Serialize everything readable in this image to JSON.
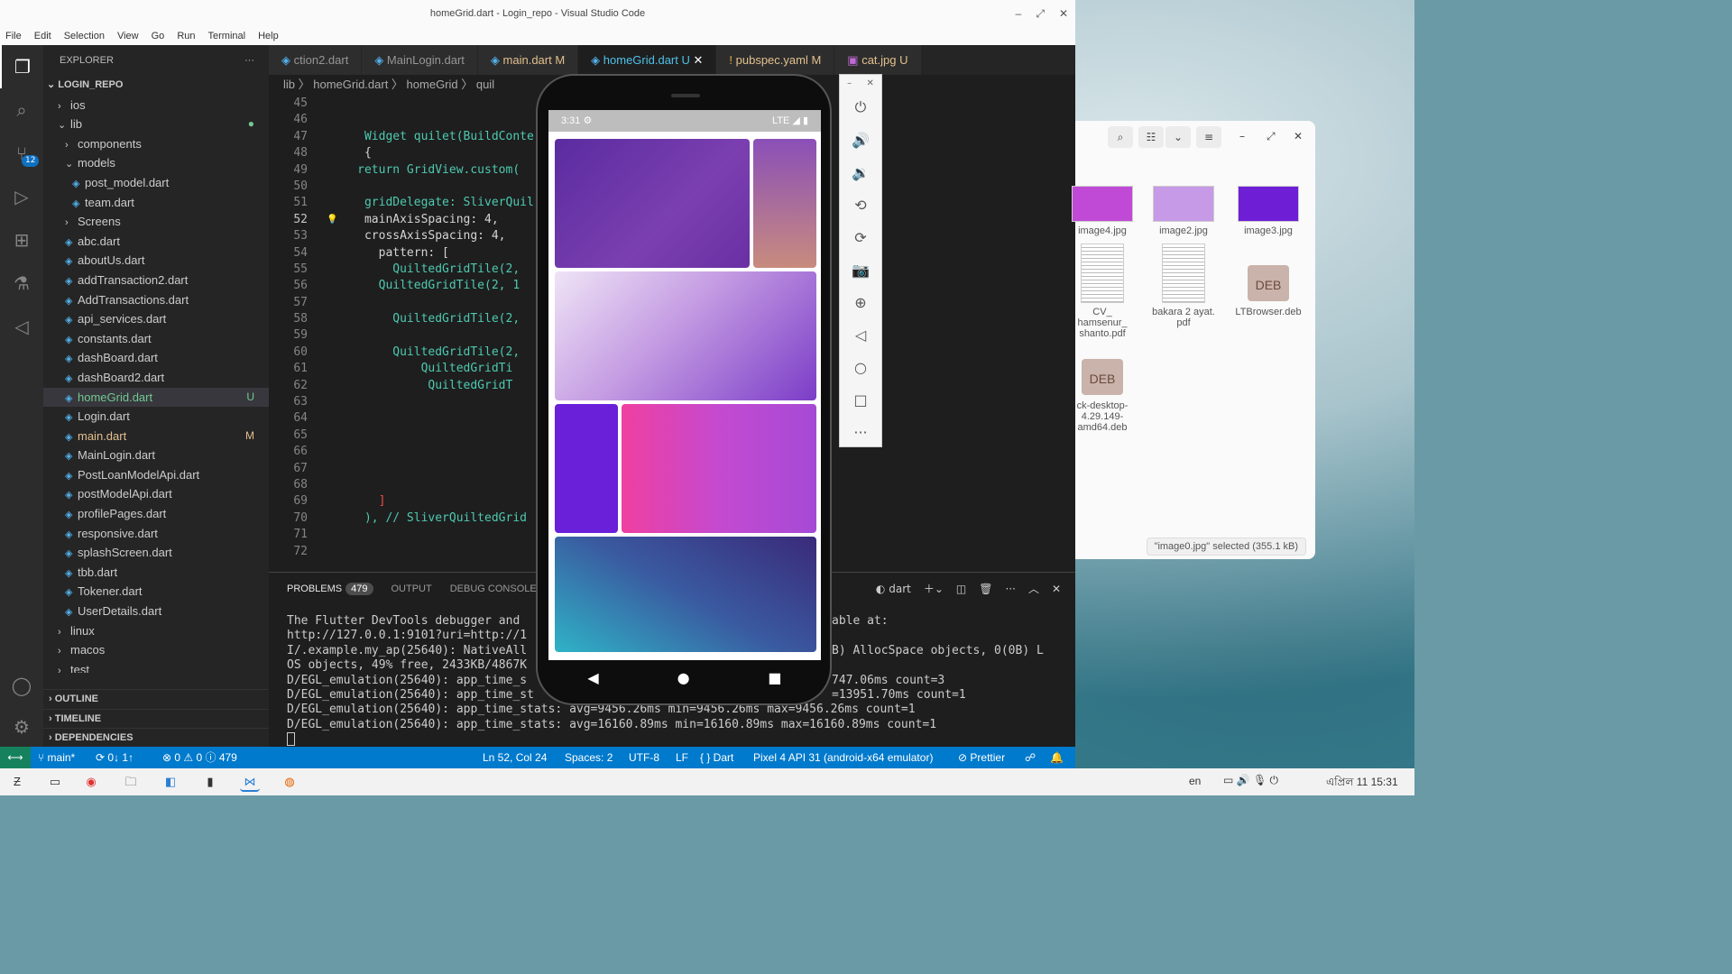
{
  "window_title": "homeGrid.dart - Login_repo - Visual Studio Code",
  "menu": [
    "File",
    "Edit",
    "Selection",
    "View",
    "Go",
    "Run",
    "Terminal",
    "Help"
  ],
  "activity": {
    "scm_badge": "12"
  },
  "explorer": {
    "title": "EXPLORER",
    "root": "LOGIN_REPO",
    "items": [
      {
        "label": "ios",
        "kind": "folder",
        "depth": 1,
        "open": false
      },
      {
        "label": "lib",
        "kind": "folder",
        "depth": 1,
        "open": true,
        "flag": "●"
      },
      {
        "label": "components",
        "kind": "folder",
        "depth": 2,
        "open": false
      },
      {
        "label": "models",
        "kind": "folder",
        "depth": 2,
        "open": true
      },
      {
        "label": "post_model.dart",
        "kind": "file",
        "depth": 3
      },
      {
        "label": "team.dart",
        "kind": "file",
        "depth": 3
      },
      {
        "label": "Screens",
        "kind": "folder",
        "depth": 2,
        "open": false
      },
      {
        "label": "abc.dart",
        "kind": "file",
        "depth": 2
      },
      {
        "label": "aboutUs.dart",
        "kind": "file",
        "depth": 2
      },
      {
        "label": "addTransaction2.dart",
        "kind": "file",
        "depth": 2
      },
      {
        "label": "AddTransactions.dart",
        "kind": "file",
        "depth": 2
      },
      {
        "label": "api_services.dart",
        "kind": "file",
        "depth": 2
      },
      {
        "label": "constants.dart",
        "kind": "file",
        "depth": 2
      },
      {
        "label": "dashBoard.dart",
        "kind": "file",
        "depth": 2
      },
      {
        "label": "dashBoard2.dart",
        "kind": "file",
        "depth": 2
      },
      {
        "label": "homeGrid.dart",
        "kind": "file",
        "depth": 2,
        "flag": "U",
        "selected": true,
        "status": "untracked"
      },
      {
        "label": "Login.dart",
        "kind": "file",
        "depth": 2
      },
      {
        "label": "main.dart",
        "kind": "file",
        "depth": 2,
        "flag": "M",
        "status": "modified"
      },
      {
        "label": "MainLogin.dart",
        "kind": "file",
        "depth": 2
      },
      {
        "label": "PostLoanModelApi.dart",
        "kind": "file",
        "depth": 2
      },
      {
        "label": "postModelApi.dart",
        "kind": "file",
        "depth": 2
      },
      {
        "label": "profilePages.dart",
        "kind": "file",
        "depth": 2
      },
      {
        "label": "responsive.dart",
        "kind": "file",
        "depth": 2
      },
      {
        "label": "splashScreen.dart",
        "kind": "file",
        "depth": 2
      },
      {
        "label": "tbb.dart",
        "kind": "file",
        "depth": 2
      },
      {
        "label": "Tokener.dart",
        "kind": "file",
        "depth": 2
      },
      {
        "label": "UserDetails.dart",
        "kind": "file",
        "depth": 2
      },
      {
        "label": "linux",
        "kind": "folder",
        "depth": 1,
        "open": false
      },
      {
        "label": "macos",
        "kind": "folder",
        "depth": 1,
        "open": false
      },
      {
        "label": "test",
        "kind": "folder",
        "depth": 1,
        "open": false
      },
      {
        "label": "web",
        "kind": "folder",
        "depth": 1,
        "open": false
      }
    ],
    "sections": [
      "OUTLINE",
      "TIMELINE",
      "DEPENDENCIES"
    ]
  },
  "tabs": [
    {
      "label": "ction2.dart",
      "status": ""
    },
    {
      "label": "MainLogin.dart",
      "status": ""
    },
    {
      "label": "main.dart M",
      "status": "modified"
    },
    {
      "label": "homeGrid.dart U",
      "status": "active"
    },
    {
      "label": "pubspec.yaml M",
      "status": "modified"
    },
    {
      "label": "cat.jpg U",
      "status": "modified"
    }
  ],
  "breadcrumbs": "lib 〉 homeGrid.dart 〉 homeGrid 〉 quil",
  "code": [
    {
      "n": "45",
      "t": ""
    },
    {
      "n": "46",
      "t": ""
    },
    {
      "n": "47",
      "t": "      Widget quilet(BuildConte"
    },
    {
      "n": "48",
      "t": "      {"
    },
    {
      "n": "49",
      "t": "     return GridView.custom("
    },
    {
      "n": "50",
      "t": ""
    },
    {
      "n": "51",
      "t": "      gridDelegate: SliverQuil"
    },
    {
      "n": "52",
      "t": "      mainAxisSpacing: 4,",
      "current": true
    },
    {
      "n": "53",
      "t": "      crossAxisSpacing: 4,"
    },
    {
      "n": "54",
      "t": "        pattern: ["
    },
    {
      "n": "55",
      "t": "          QuiltedGridTile(2,"
    },
    {
      "n": "56",
      "t": "        QuiltedGridTile(2, 1"
    },
    {
      "n": "57",
      "t": ""
    },
    {
      "n": "58",
      "t": "          QuiltedGridTile(2,"
    },
    {
      "n": "59",
      "t": ""
    },
    {
      "n": "60",
      "t": "          QuiltedGridTile(2,"
    },
    {
      "n": "61",
      "t": "              QuiltedGridTi"
    },
    {
      "n": "62",
      "t": "               QuiltedGridT"
    },
    {
      "n": "63",
      "t": ""
    },
    {
      "n": "64",
      "t": ""
    },
    {
      "n": "65",
      "t": ""
    },
    {
      "n": "66",
      "t": ""
    },
    {
      "n": "67",
      "t": ""
    },
    {
      "n": "68",
      "t": ""
    },
    {
      "n": "69",
      "t": "        ]"
    },
    {
      "n": "70",
      "t": "      ), // SliverQuiltedGrid"
    },
    {
      "n": "71",
      "t": ""
    },
    {
      "n": "72",
      "t": ""
    }
  ],
  "panel": {
    "tabs": [
      "PROBLEMS",
      "OUTPUT",
      "DEBUG CONSOLE"
    ],
    "problems_count": "479",
    "terminal_name": "dart",
    "terminal": [
      "The Flutter DevTools debugger and ",
      "http://127.0.0.1:9101?uri=http://1",
      "I/.example.my_ap(25640): NativeAll",
      "OS objects, 49% free, 2433KB/4867K",
      "D/EGL_emulation(25640): app_time_s",
      "D/EGL_emulation(25640): app_time_st",
      "D/EGL_emulation(25640): app_time_stats: avg=9456.26ms min=9456.26ms max=9456.26ms count=1",
      "D/EGL_emulation(25640): app_time_stats: avg=16160.89ms min=16160.89ms max=16160.89ms count=1"
    ],
    "terminal_right": [
      "able at:",
      "",
      "B) AllocSpace objects, 0(0B) L",
      "",
      "747.06ms count=3",
      "=13951.70ms count=1"
    ]
  },
  "statusbar": {
    "branch": "main*",
    "sync": "0↓ 1↑",
    "errors": "⊗ 0 ⚠ 0 ⓘ 479",
    "position": "Ln 52, Col 24",
    "spaces": "Spaces: 2",
    "encoding": "UTF-8",
    "eol": "LF",
    "language": "{ } Dart",
    "device": "Pixel 4 API 31 (android-x64 emulator)",
    "prettier": "Prettier"
  },
  "emulator": {
    "time": "3:31",
    "network": "LTE"
  },
  "files": {
    "items": [
      {
        "name": "image4.jpg",
        "type": "image",
        "color": "#c04ad6"
      },
      {
        "name": "image2.jpg",
        "type": "image",
        "color": "#c69ae6"
      },
      {
        "name": "image3.jpg",
        "type": "image",
        "color": "#6e1fd6"
      },
      {
        "name": "CV_\nhamsenur_\nshanto.pdf",
        "type": "pdf"
      },
      {
        "name": "bakara 2 ayat.\npdf",
        "type": "pdf"
      },
      {
        "name": "LTBrowser.deb",
        "type": "deb"
      },
      {
        "name": "ck-desktop-\n4.29.149-\namd64.deb",
        "type": "deb"
      }
    ],
    "deb_label": "DEB",
    "selection_status": "\"image0.jpg\" selected (355.1 kB)"
  },
  "taskbar": {
    "lang": "en",
    "clock": "এপ্রিল 11  15:31"
  }
}
